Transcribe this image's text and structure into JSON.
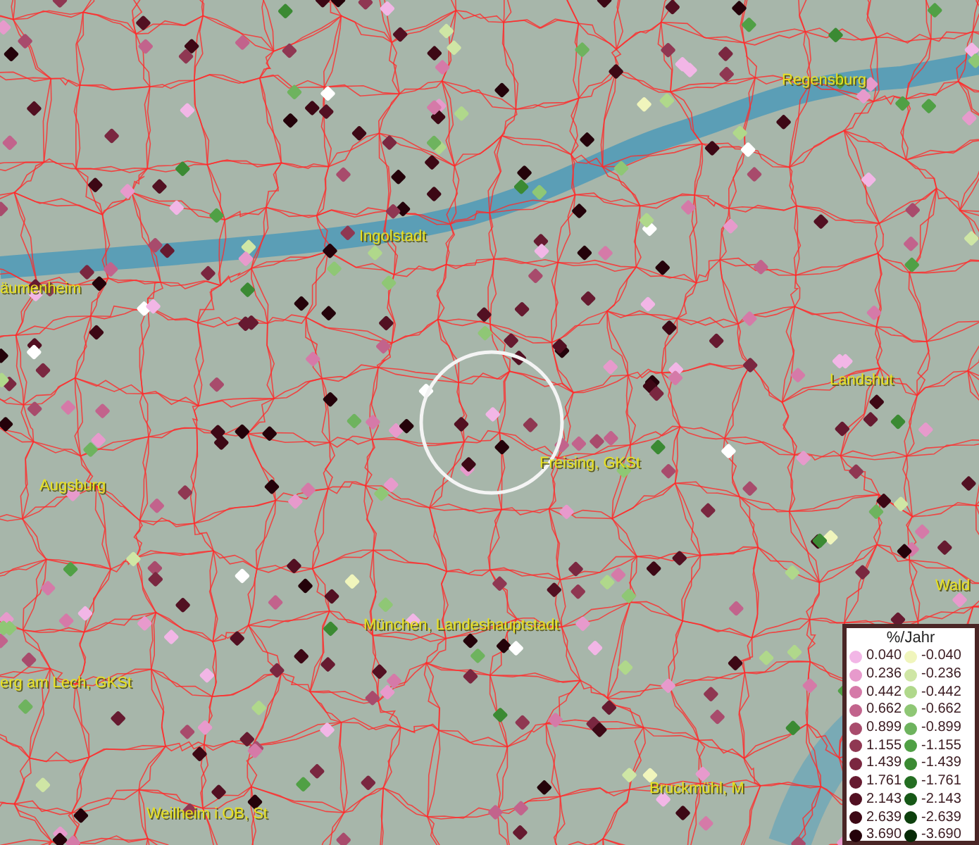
{
  "map": {
    "labels": [
      {
        "text": "Regensburg"
      },
      {
        "text": "Ingolstadt"
      },
      {
        "text": "äumenheim"
      },
      {
        "text": "Landshut"
      },
      {
        "text": "Augsburg"
      },
      {
        "text": "Freising, GKSt"
      },
      {
        "text": "München, Landeshauptstadt"
      },
      {
        "text": "erg am Lech, GKSt"
      },
      {
        "text": "Weilheim i.OB, St"
      },
      {
        "text": "Bruckmühl, M"
      },
      {
        "text": "Wald"
      }
    ]
  },
  "legend": {
    "title": "%/Jahr",
    "positive": [
      {
        "value": "0.040",
        "color": "#f2b6e6"
      },
      {
        "value": "0.236",
        "color": "#e79acc"
      },
      {
        "value": "0.442",
        "color": "#d57aa8"
      },
      {
        "value": "0.662",
        "color": "#c2638c"
      },
      {
        "value": "0.899",
        "color": "#a84b6c"
      },
      {
        "value": "1.155",
        "color": "#8f3752"
      },
      {
        "value": "1.439",
        "color": "#7a2740"
      },
      {
        "value": "1.761",
        "color": "#661a30"
      },
      {
        "value": "2.143",
        "color": "#521022"
      },
      {
        "value": "2.639",
        "color": "#3d0815"
      },
      {
        "value": "3.690",
        "color": "#24020a"
      }
    ],
    "negative": [
      {
        "value": "-0.040",
        "color": "#f0f5bc"
      },
      {
        "value": "-0.236",
        "color": "#cfe6a5"
      },
      {
        "value": "-0.442",
        "color": "#b0d88b"
      },
      {
        "value": "-0.662",
        "color": "#8fc775"
      },
      {
        "value": "-0.899",
        "color": "#6eb35e"
      },
      {
        "value": "-1.155",
        "color": "#50a045"
      },
      {
        "value": "-1.439",
        "color": "#3b8a33"
      },
      {
        "value": "-1.761",
        "color": "#246e22"
      },
      {
        "value": "-2.143",
        "color": "#165816"
      },
      {
        "value": "-2.639",
        "color": "#0d400d"
      },
      {
        "value": "-3.690",
        "color": "#072a07"
      }
    ]
  }
}
